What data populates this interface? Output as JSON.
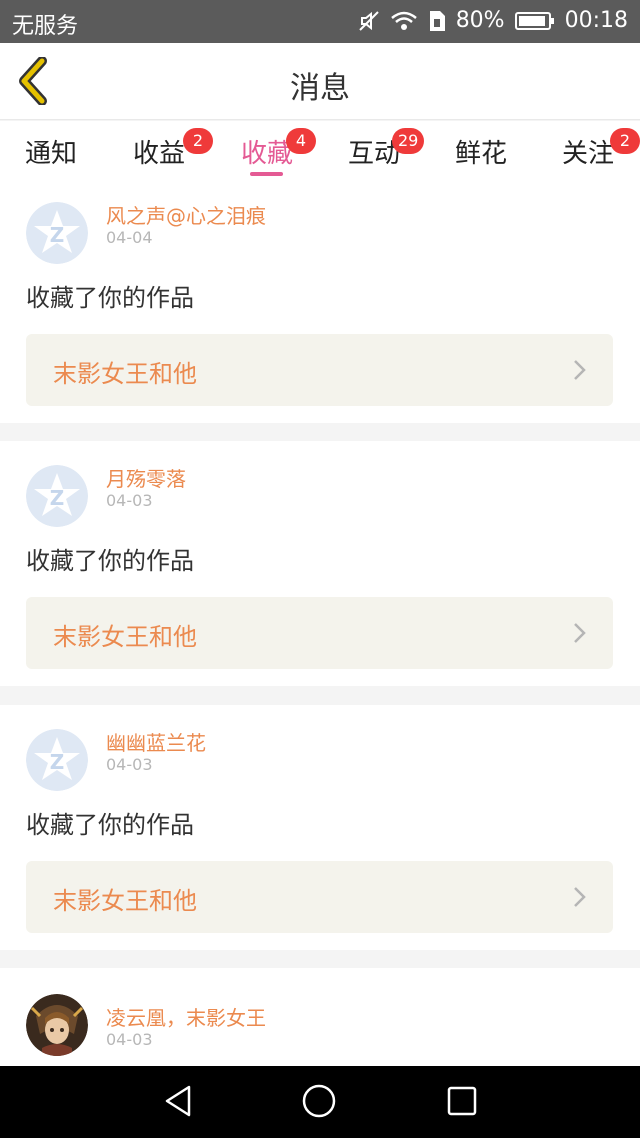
{
  "status_bar": {
    "carrier": "无服务",
    "battery": "80%",
    "time": "00:18"
  },
  "header": {
    "title": "消息"
  },
  "tabs": [
    {
      "label": "通知",
      "badge": ""
    },
    {
      "label": "收益",
      "badge": "2"
    },
    {
      "label": "收藏",
      "badge": "4",
      "active": true
    },
    {
      "label": "互动",
      "badge": "29"
    },
    {
      "label": "鲜花",
      "badge": ""
    },
    {
      "label": "关注",
      "badge": "2"
    }
  ],
  "messages": [
    {
      "user": "风之声@心之泪痕",
      "date": "04-04",
      "action": "收藏了你的作品",
      "work": "末影女王和他",
      "avatar_icon": "default-star-avatar-icon"
    },
    {
      "user": "月殇零落",
      "date": "04-03",
      "action": "收藏了你的作品",
      "work": "末影女王和他",
      "avatar_icon": "default-star-avatar-icon"
    },
    {
      "user": "幽幽蓝兰花",
      "date": "04-03",
      "action": "收藏了你的作品",
      "work": "末影女王和他",
      "avatar_icon": "default-star-avatar-icon"
    },
    {
      "user": "凌云凰，末影女王",
      "date": "04-03",
      "action": "",
      "work": "",
      "avatar_icon": "anime-portrait-avatar"
    }
  ],
  "colors": {
    "accent": "#e45a94",
    "username": "#eb8a4f",
    "badge": "#ef3a3a",
    "back_icon": "#e5c100"
  }
}
